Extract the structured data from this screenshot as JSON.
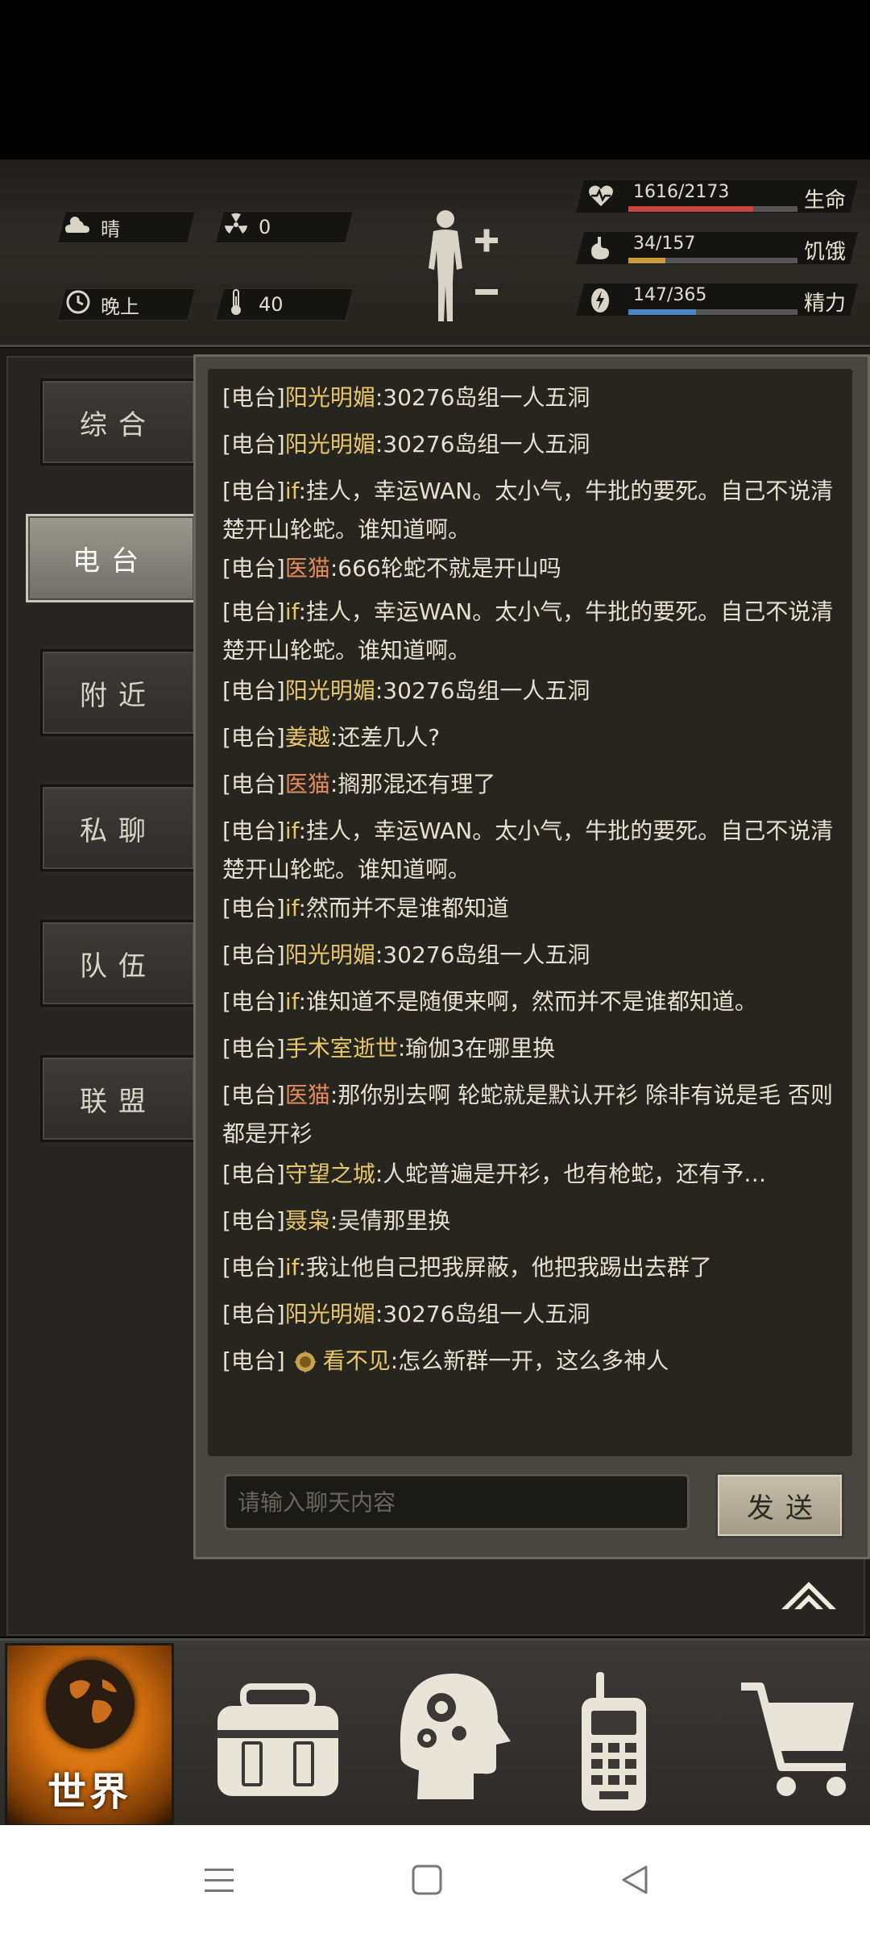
{
  "status": {
    "weather": "晴",
    "radiation": "0",
    "time_of_day": "晚上",
    "temperature": "40"
  },
  "stats": [
    {
      "key": "health",
      "value": "1616/2173",
      "label": "生命",
      "fill": 0.74,
      "color": "#c9453f",
      "icon": "heart-rate-icon"
    },
    {
      "key": "hunger",
      "value": "34/157",
      "label": "饥饿",
      "fill": 0.22,
      "color": "#c89a3c",
      "icon": "stomach-icon"
    },
    {
      "key": "energy",
      "value": "147/365",
      "label": "精力",
      "fill": 0.4,
      "color": "#4b86c4",
      "icon": "energy-icon"
    }
  ],
  "sidebar": {
    "tabs": [
      {
        "label": "综合",
        "active": false
      },
      {
        "label": "电台",
        "active": true
      },
      {
        "label": "附近",
        "active": false
      },
      {
        "label": "私聊",
        "active": false
      },
      {
        "label": "队伍",
        "active": false
      },
      {
        "label": "联盟",
        "active": false
      }
    ]
  },
  "chat": {
    "messages": [
      {
        "tag": "[电台]",
        "name": "阳光明媚",
        "style": "y",
        "text": ":30276岛组一人五洞"
      },
      {
        "tag": "[电台]",
        "name": "阳光明媚",
        "style": "y",
        "text": ":30276岛组一人五洞"
      },
      {
        "tag": "[电台]",
        "name": "if",
        "style": "y",
        "text": ":挂人，幸运WAN。太小气，牛批的要死。自己不说清楚开山轮蛇。谁知道啊。"
      },
      {
        "tag": "[电台]",
        "name": "医猫",
        "style": "o",
        "text": ":666轮蛇不就是开山吗"
      },
      {
        "tag": "[电台]",
        "name": "if",
        "style": "y",
        "text": ":挂人，幸运WAN。太小气，牛批的要死。自己不说清楚开山轮蛇。谁知道啊。"
      },
      {
        "tag": "[电台]",
        "name": "阳光明媚",
        "style": "y",
        "text": ":30276岛组一人五洞"
      },
      {
        "tag": "[电台]",
        "name": "姜越",
        "style": "y",
        "text": ":还差几人?"
      },
      {
        "tag": "[电台]",
        "name": "医猫",
        "style": "o",
        "text": ":搁那混还有理了"
      },
      {
        "tag": "[电台]",
        "name": "if",
        "style": "y",
        "text": ":挂人，幸运WAN。太小气，牛批的要死。自己不说清楚开山轮蛇。谁知道啊。"
      },
      {
        "tag": "[电台]",
        "name": "if",
        "style": "y",
        "text": ":然而并不是谁都知道"
      },
      {
        "tag": "[电台]",
        "name": "阳光明媚",
        "style": "y",
        "text": ":30276岛组一人五洞"
      },
      {
        "tag": "[电台]",
        "name": "if",
        "style": "y",
        "text": ":谁知道不是随便来啊，然而并不是谁都知道。"
      },
      {
        "tag": "[电台]",
        "name": "手术室逝世",
        "style": "y",
        "text": ":瑜伽3在哪里换"
      },
      {
        "tag": "[电台]",
        "name": "医猫",
        "style": "o",
        "text": ":那你别去啊 轮蛇就是默认开衫 除非有说是毛 否则都是开衫"
      },
      {
        "tag": "[电台]",
        "name": "守望之城",
        "style": "y",
        "text": ":人蛇普遍是开衫，也有枪蛇，还有予…"
      },
      {
        "tag": "[电台]",
        "name": "聂枭",
        "style": "y",
        "text": ":吴倩那里换"
      },
      {
        "tag": "[电台]",
        "name": "if",
        "style": "y",
        "text": ":我让他自己把我屏蔽，他把我踢出去群了"
      },
      {
        "tag": "[电台]",
        "name": "阳光明媚",
        "style": "y",
        "text": ":30276岛组一人五洞"
      },
      {
        "tag": "[电台]",
        "name": "看不见",
        "style": "y",
        "text": ":怎么新群一开，这么多神人",
        "emblem": true
      }
    ],
    "input_placeholder": "请输入聊天内容",
    "send_label": "发送"
  },
  "bottom_nav": {
    "world_label": "世界",
    "items": [
      "backpack-icon",
      "skills-head-icon",
      "radio-device-icon",
      "shop-cart-icon"
    ]
  }
}
